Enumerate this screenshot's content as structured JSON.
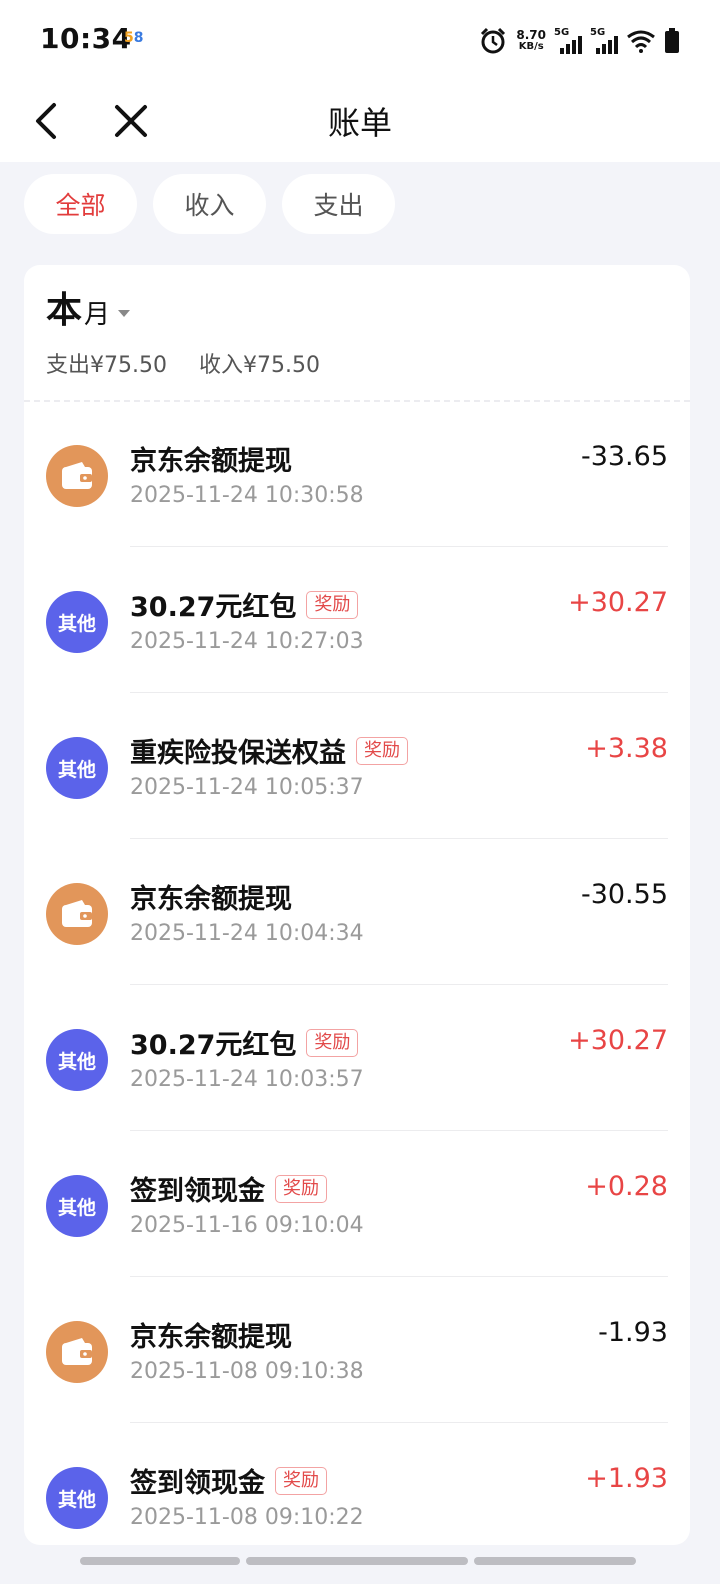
{
  "status_bar": {
    "time": "10:34",
    "app_badge": [
      "5",
      "8"
    ],
    "net_speed": "8.70",
    "net_unit": "KB/s",
    "sim1": "5G",
    "sim2": "5G"
  },
  "header": {
    "title": "账单"
  },
  "filters": [
    {
      "label": "全部",
      "active": true
    },
    {
      "label": "收入",
      "active": false
    },
    {
      "label": "支出",
      "active": false
    }
  ],
  "summary": {
    "period_big": "本",
    "period_small": "月",
    "expense": "支出¥75.50",
    "income": "收入¥75.50"
  },
  "transactions": [
    {
      "title": "京东余额提现",
      "tag": "",
      "time": "2025-11-24 10:30:58",
      "amount": "-33.65",
      "icon": "wallet-icon",
      "avatar_label": ""
    },
    {
      "title": "30.27元红包",
      "tag": "奖励",
      "time": "2025-11-24 10:27:03",
      "amount": "+30.27",
      "icon": "other",
      "avatar_label": "其他"
    },
    {
      "title": "重疾险投保送权益",
      "tag": "奖励",
      "time": "2025-11-24 10:05:37",
      "amount": "+3.38",
      "icon": "other",
      "avatar_label": "其他"
    },
    {
      "title": "京东余额提现",
      "tag": "",
      "time": "2025-11-24 10:04:34",
      "amount": "-30.55",
      "icon": "wallet-icon",
      "avatar_label": ""
    },
    {
      "title": "30.27元红包",
      "tag": "奖励",
      "time": "2025-11-24 10:03:57",
      "amount": "+30.27",
      "icon": "other",
      "avatar_label": "其他"
    },
    {
      "title": "签到领现金",
      "tag": "奖励",
      "time": "2025-11-16 09:10:04",
      "amount": "+0.28",
      "icon": "other",
      "avatar_label": "其他"
    },
    {
      "title": "京东余额提现",
      "tag": "",
      "time": "2025-11-08 09:10:38",
      "amount": "-1.93",
      "icon": "wallet-icon",
      "avatar_label": ""
    },
    {
      "title": "签到领现金",
      "tag": "奖励",
      "time": "2025-11-08 09:10:22",
      "amount": "+1.93",
      "icon": "other",
      "avatar_label": "其他"
    }
  ],
  "colors": {
    "accent_red": "#e84545",
    "wallet_orange": "#e2965a",
    "other_blue": "#5b63ea",
    "background": "#f3f4f9"
  }
}
